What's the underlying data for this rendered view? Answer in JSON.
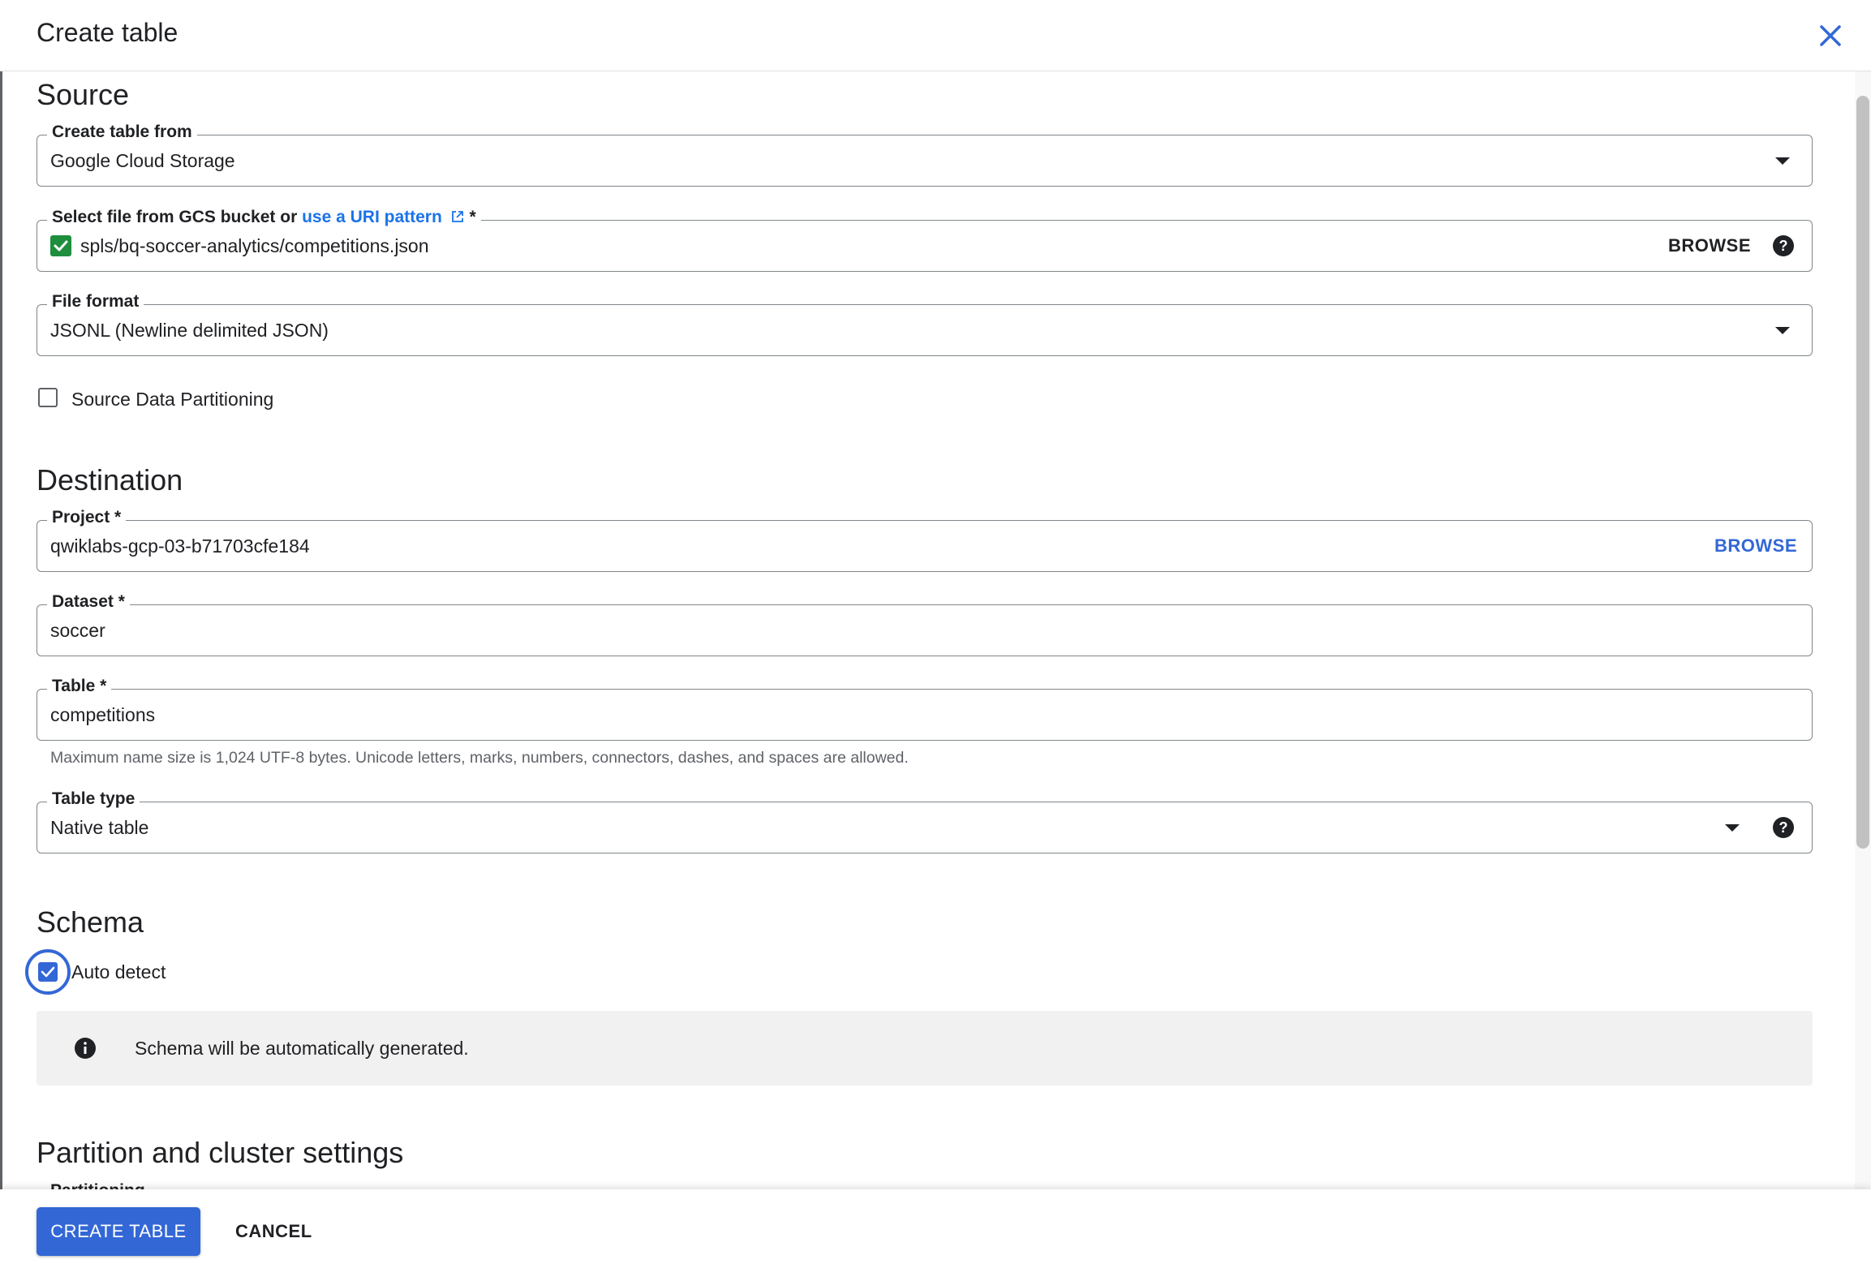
{
  "dialog": {
    "title": "Create table"
  },
  "source": {
    "heading": "Source",
    "create_from": {
      "label": "Create table from",
      "value": "Google Cloud Storage"
    },
    "gcs_file": {
      "label_prefix": "Select file from GCS bucket or ",
      "label_link": "use a URI pattern",
      "required_mark": " *",
      "value": "spls/bq-soccer-analytics/competitions.json",
      "browse_label": "BROWSE"
    },
    "file_format": {
      "label": "File format",
      "value": "JSONL (Newline delimited JSON)"
    },
    "partitioning_checkbox": {
      "label": "Source Data Partitioning",
      "checked": false
    }
  },
  "destination": {
    "heading": "Destination",
    "project": {
      "label": "Project *",
      "value": "qwiklabs-gcp-03-b71703cfe184",
      "browse_label": "BROWSE"
    },
    "dataset": {
      "label": "Dataset *",
      "value": "soccer"
    },
    "table": {
      "label": "Table *",
      "value": "competitions",
      "hint": "Maximum name size is 1,024 UTF-8 bytes. Unicode letters, marks, numbers, connectors, dashes, and spaces are allowed."
    },
    "table_type": {
      "label": "Table type",
      "value": "Native table"
    }
  },
  "schema": {
    "heading": "Schema",
    "auto_detect": {
      "label": "Auto detect",
      "checked": true
    },
    "info": "Schema will be automatically generated."
  },
  "partition": {
    "heading": "Partition and cluster settings",
    "peek_label": "Partitioning"
  },
  "footer": {
    "create_label": "CREATE TABLE",
    "cancel_label": "CANCEL"
  },
  "colors": {
    "accent": "#3367d6",
    "link": "#1a73e8",
    "success": "#1e8e3e",
    "border": "#80868b"
  }
}
